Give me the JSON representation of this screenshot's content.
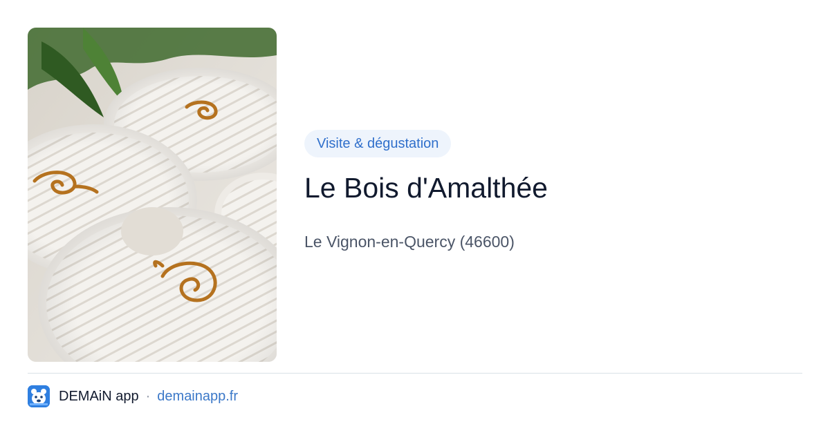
{
  "card": {
    "image": {
      "icon": "cheese-photo",
      "alt": ""
    },
    "tag": "Visite & dégustation",
    "title": "Le Bois d'Amalthée",
    "location": "Le Vignon-en-Quercy (46600)"
  },
  "footer": {
    "app_icon": "demain-app-icon",
    "app_name": "DEMAiN app",
    "separator": "·",
    "site": "demainapp.fr"
  },
  "colors": {
    "accent": "#2f6fcb",
    "tag_background": "#eef4fc",
    "title": "#111a2e",
    "subtitle": "#4b5567",
    "link": "#3b78c8",
    "divider": "#d9e1e7",
    "app_icon": "#2f7fe0"
  }
}
